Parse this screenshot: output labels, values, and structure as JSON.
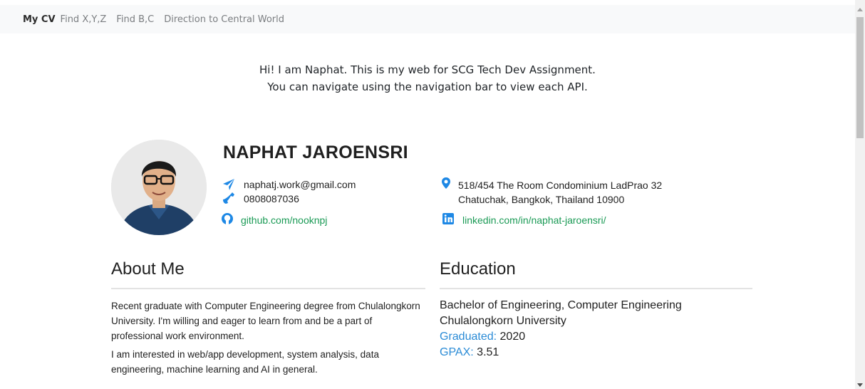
{
  "nav": {
    "items": [
      {
        "label": "My CV",
        "active": true
      },
      {
        "label": "Find X,Y,Z",
        "active": false
      },
      {
        "label": "Find B,C",
        "active": false
      },
      {
        "label": "Direction to Central World",
        "active": false
      }
    ]
  },
  "intro": {
    "line1": "Hi! I am Naphat. This is my web for SCG Tech Dev Assignment.",
    "line2": "You can navigate using the navigation bar to view each API."
  },
  "profile": {
    "name": "NAPHAT JAROENSRI",
    "email": "naphatj.work@gmail.com",
    "phone": "0808087036",
    "github": "github.com/nooknpj",
    "address_line1": "518/454 The Room Condominium LadPrao 32",
    "address_line2": "Chatuchak, Bangkok, Thailand 10900",
    "linkedin": "linkedin.com/in/naphat-jaroensri/"
  },
  "about": {
    "title": "About Me",
    "p1": "Recent graduate with Computer Engineering  degree from Chulalongkorn University. I'm willing and eager to learn from and be a part of professional work environment.",
    "p2": "I am interested in web/app development, system analysis, data engineering, machine learning and AI in general."
  },
  "education": {
    "title": "Education",
    "degree": "Bachelor of Engineering, Computer Engineering",
    "university": "Chulalongkorn University",
    "graduated_label": "Graduated:",
    "graduated_value": "2020",
    "gpax_label": "GPAX:",
    "gpax_value": "3.51"
  },
  "icons": {
    "email": "paper-plane-icon",
    "phone": "phone-icon",
    "github": "github-icon",
    "address": "map-marker-icon",
    "linkedin": "linkedin-icon"
  },
  "colors": {
    "icon_blue": "#1e88e5",
    "link_green": "#1a9a55",
    "label_blue": "#2a8bd6",
    "navbar_bg": "#f8f9fa"
  }
}
